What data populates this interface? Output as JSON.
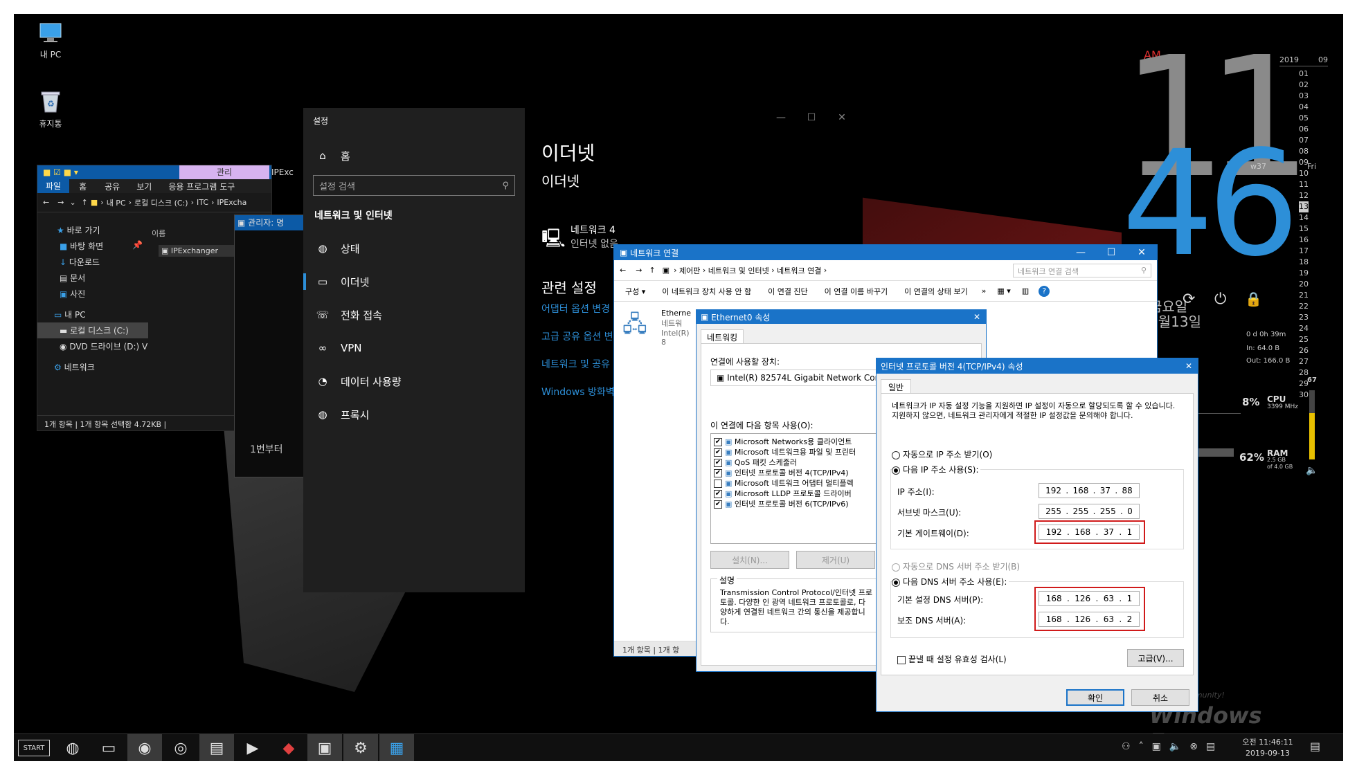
{
  "desktop": {
    "icons": [
      {
        "label": "내 PC"
      },
      {
        "label": "휴지통"
      }
    ],
    "watermark": "Windows Forum",
    "watermark_sub": "Best Windows Community!"
  },
  "clock": {
    "ampm": "AM",
    "hour": "11",
    "minute": "46",
    "weekday": "금요일",
    "date": "9월13일",
    "calendar": {
      "year": "2019",
      "month": "09",
      "week": "w37",
      "weekday_abbr": "Fri",
      "today": "13",
      "days": [
        "01",
        "02",
        "03",
        "04",
        "05",
        "06",
        "07",
        "08",
        "09",
        "10",
        "11",
        "12",
        "13",
        "14",
        "15",
        "16",
        "17",
        "18",
        "19",
        "20",
        "21",
        "22",
        "23",
        "24",
        "25",
        "26",
        "27",
        "28",
        "29",
        "30"
      ]
    }
  },
  "sysmon": {
    "uptime": "0 d 0h 39m",
    "net_in": "In: 64.0 B",
    "net_out": "Out: 166.0 B",
    "cpu_pct": "8%",
    "cpu_label": "CPU",
    "cpu_freq": "3399 MHz",
    "ram_pct": "62%",
    "ram_label": "RAM",
    "ram_used": "2.5 GB",
    "ram_total": "of 4.0 GB",
    "volume": "67",
    "volume_level": 0.67
  },
  "explorer": {
    "ribbon_tabs": [
      "파일",
      "홈",
      "공유",
      "보기",
      "응용 프로그램 도구"
    ],
    "context_tab": "관리",
    "title_fragment": "IPExc",
    "path": [
      "내 PC",
      "로컬 디스크 (C:)",
      "ITC",
      "IPExcha"
    ],
    "nav_items": [
      {
        "label": "바로 가기"
      },
      {
        "label": "바탕 화면"
      },
      {
        "label": "다운로드"
      },
      {
        "label": "문서"
      },
      {
        "label": "사진"
      },
      {
        "label": "내 PC"
      },
      {
        "label": "로컬 디스크 (C:)"
      },
      {
        "label": "DVD 드라이브 (D:) V"
      },
      {
        "label": "네트워크"
      }
    ],
    "column_name": "이름",
    "file": "IPExchanger",
    "status": "1개 항목  |  1개 항목 선택함 4.72KB  |"
  },
  "cmd": {
    "title": "관리자: 명",
    "text": "1번부터"
  },
  "settings": {
    "window_title": "설정",
    "home": "홈",
    "search_placeholder": "설정 검색",
    "section": "네트워크 및 인터넷",
    "nav": [
      {
        "label": "상태",
        "icon": "globe-icon"
      },
      {
        "label": "이더넷",
        "icon": "monitor-icon"
      },
      {
        "label": "전화 접속",
        "icon": "phone-icon"
      },
      {
        "label": "VPN",
        "icon": "vpn-icon"
      },
      {
        "label": "데이터 사용량",
        "icon": "data-icon"
      },
      {
        "label": "프록시",
        "icon": "globe-icon"
      }
    ],
    "page_title": "이더넷",
    "sub_title": "이더넷",
    "adapter_name": "네트워크 4",
    "adapter_status": "인터넷 없음",
    "related_title": "관련 설정",
    "links": [
      "어댑터 옵션 변경",
      "고급 공유 옵션 변",
      "네트워크 및 공유",
      "Windows 방화벽"
    ]
  },
  "netconn": {
    "title": "네트워크 연결",
    "path": [
      "제어판",
      "네트워크 및 인터넷",
      "네트워크 연결"
    ],
    "search_placeholder": "네트워크 연결 검색",
    "toolbar": [
      "구성 ▾",
      "이 네트워크 장치 사용 안 함",
      "이 연결 진단",
      "이 연결 이름 바꾸기",
      "이 연결의 상태 보기",
      "»"
    ],
    "item_name": "Etherne",
    "item_line2": "네트워",
    "item_line3": "Intel(R) 8",
    "status": "1개 항목  |  1개 항"
  },
  "ethprop": {
    "title": "Ethernet0 속성",
    "tab": "네트워킹",
    "connect_using": "연결에 사용할 장치:",
    "device": "Intel(R) 82574L Gigabit Network Con",
    "items_label": "이 연결에 다음 항목 사용(O):",
    "items": [
      {
        "label": "Microsoft Networks용 클라이언트",
        "checked": "✔"
      },
      {
        "label": "Microsoft 네트워크용 파일 및 프린터",
        "checked": "✔"
      },
      {
        "label": "QoS 패킷 스케줄러",
        "checked": "✔"
      },
      {
        "label": "인터넷 프로토콜 버전 4(TCP/IPv4)",
        "checked": "✔"
      },
      {
        "label": "Microsoft 네트워크 어댑터 멀티플렉",
        "checked": ""
      },
      {
        "label": "Microsoft LLDP 프로토콜 드라이버",
        "checked": "✔"
      },
      {
        "label": "인터넷 프로토콜 버전 6(TCP/IPv6)",
        "checked": "✔"
      }
    ],
    "install": "설치(N)...",
    "remove": "제거(U)",
    "desc_group": "설명",
    "desc": "Transmission Control Protocol/인터넷 프로토콜. 다양한 인 광역 네트워크 프로토콜로, 다양하게 연결된 네트워크 간의 통신을 제공합니다."
  },
  "ipv4": {
    "title": "인터넷 프로토콜 버전 4(TCP/IPv4) 속성",
    "tab": "일반",
    "intro": "네트워크가 IP 자동 설정 기능을 지원하면 IP 설정이 자동으로 할당되도록 할 수 있습니다. 지원하지 않으면, 네트워크 관리자에게 적절한 IP 설정값을 문의해야 합니다.",
    "auto_ip": "자동으로 IP 주소 받기(O)",
    "manual_ip": "다음 IP 주소 사용(S):",
    "ip_label": "IP 주소(I):",
    "ip": [
      "192",
      "168",
      "37",
      "88"
    ],
    "mask_label": "서브넷 마스크(U):",
    "mask": [
      "255",
      "255",
      "255",
      "0"
    ],
    "gw_label": "기본 게이트웨이(D):",
    "gw": [
      "192",
      "168",
      "37",
      "1"
    ],
    "auto_dns": "자동으로 DNS 서버 주소 받기(B)",
    "manual_dns": "다음 DNS 서버 주소 사용(E):",
    "dns1_label": "기본 설정 DNS 서버(P):",
    "dns1": [
      "168",
      "126",
      "63",
      "1"
    ],
    "dns2_label": "보조 DNS 서버(A):",
    "dns2": [
      "168",
      "126",
      "63",
      "2"
    ],
    "validate": "끝낼 때 설정 유효성 검사(L)",
    "advanced": "고급(V)...",
    "ok": "확인",
    "cancel": "취소"
  },
  "taskbar": {
    "start": "START",
    "time": "오전 11:46:11",
    "date": "2019-09-13"
  },
  "colors": {
    "accent": "#2d8fd8",
    "highlight": "#d01a1a",
    "titlebar": "#1a73c8"
  }
}
